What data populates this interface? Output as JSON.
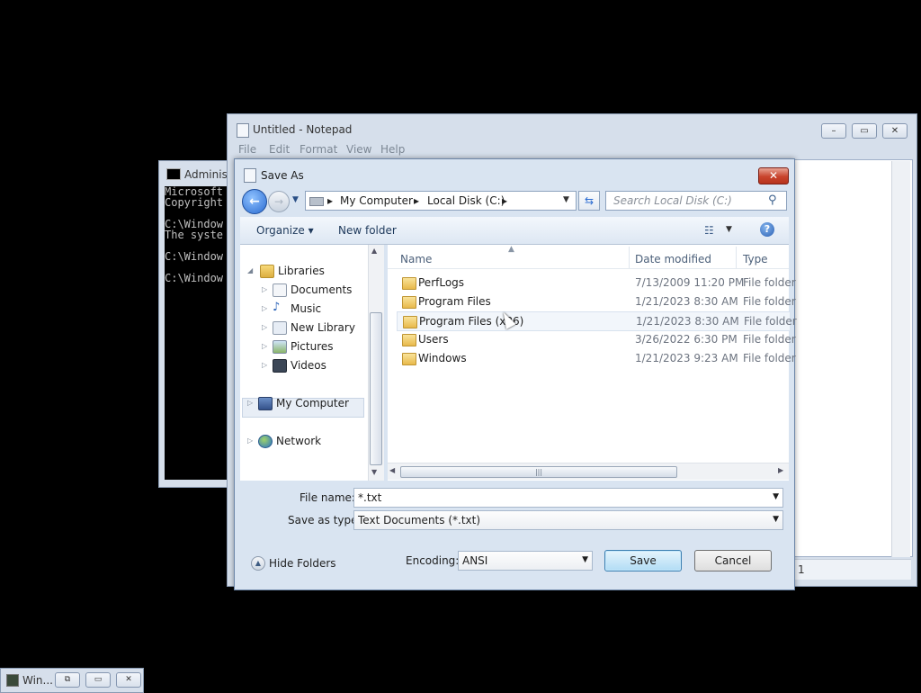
{
  "console": {
    "title": "Administ",
    "lines": "Microsoft\nCopyright\n\nC:\\Window\nThe syste\n\nC:\\Window\n\nC:\\Window"
  },
  "notepad": {
    "title": "Untitled - Notepad",
    "menu": [
      "File",
      "Edit",
      "Format",
      "View",
      "Help"
    ],
    "caption_buttons": {
      "minimize": "–",
      "maximize": "▭",
      "close": "✕"
    },
    "status": "1"
  },
  "dialog": {
    "title": "Save As",
    "close_label": "✕",
    "back_label": "←",
    "forward_label": "→",
    "address": {
      "crumbs": [
        "My Computer",
        "Local Disk (C:)"
      ],
      "separator": "▸"
    },
    "search_placeholder": "Search Local Disk (C:)",
    "toolbar": {
      "organize": "Organize ▾",
      "new_folder": "New folder",
      "help": "?"
    },
    "nav": {
      "libraries": "Libraries",
      "items": [
        "Documents",
        "Music",
        "New Library",
        "Pictures",
        "Videos"
      ],
      "my_computer": "My Computer",
      "network": "Network"
    },
    "columns": {
      "name": "Name",
      "date": "Date modified",
      "type": "Type"
    },
    "files": [
      {
        "name": "PerfLogs",
        "date": "7/13/2009 11:20 PM",
        "type": "File folder"
      },
      {
        "name": "Program Files",
        "date": "1/21/2023 8:30 AM",
        "type": "File folder"
      },
      {
        "name": "Program Files (x86)",
        "date": "1/21/2023 8:30 AM",
        "type": "File folder"
      },
      {
        "name": "Users",
        "date": "3/26/2022 6:30 PM",
        "type": "File folder"
      },
      {
        "name": "Windows",
        "date": "1/21/2023 9:23 AM",
        "type": "File folder"
      }
    ],
    "file_name_label": "File name:",
    "file_name_value": "*.txt",
    "save_type_label": "Save as type:",
    "save_type_value": "Text Documents (*.txt)",
    "hide_folders": "Hide Folders",
    "encoding_label": "Encoding:",
    "encoding_value": "ANSI",
    "save_label": "Save",
    "cancel_label": "Cancel"
  },
  "taskbar": {
    "title": "Win..."
  }
}
